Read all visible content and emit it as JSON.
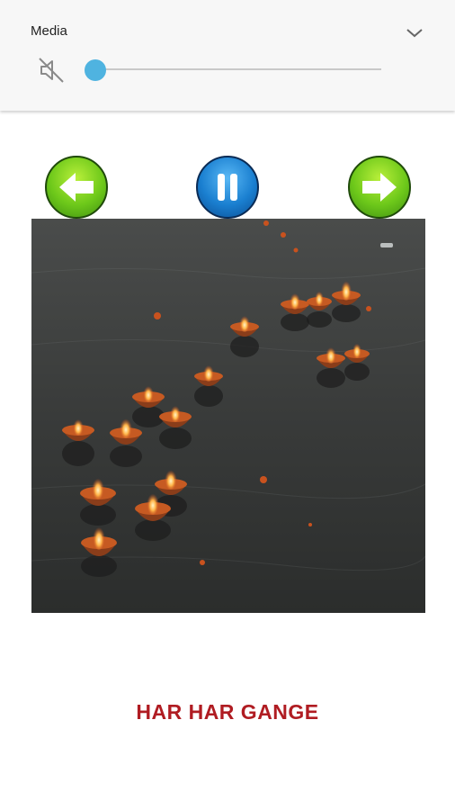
{
  "media_panel": {
    "title": "Media",
    "volume_level": 0.0,
    "muted": true,
    "accent_color": "#4fb3e0",
    "icons": {
      "mute": "volume-mute-icon",
      "collapse": "chevron-down-icon"
    }
  },
  "controls": {
    "prev_icon": "arrow-left-icon",
    "pause_icon": "pause-icon",
    "next_icon": "arrow-right-icon",
    "prev_color": "#6dc81a",
    "pause_color": "#1a7fd0",
    "next_color": "#6dc81a"
  },
  "song": {
    "title": "HAR HAR GANGE",
    "title_color": "#b01c22"
  }
}
